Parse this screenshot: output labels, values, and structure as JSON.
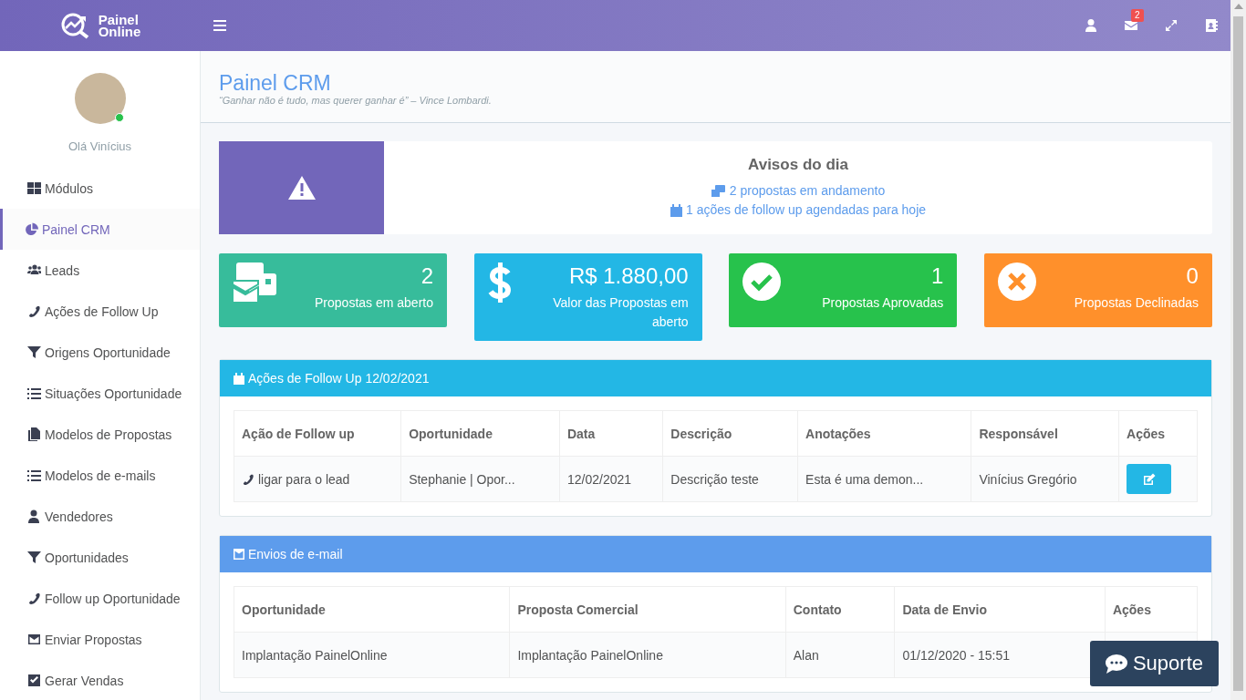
{
  "brand": {
    "line1": "Painel",
    "line2": "Online"
  },
  "topbar": {
    "mail_badge": "2"
  },
  "user": {
    "greeting": "Olá Vinícius",
    "online": true
  },
  "sidebar": {
    "items": [
      {
        "label": "Módulos",
        "selected": false
      },
      {
        "label": "Painel CRM",
        "selected": true
      },
      {
        "label": "Leads",
        "selected": false
      },
      {
        "label": "Ações de Follow Up",
        "selected": false
      },
      {
        "label": "Origens Oportunidade",
        "selected": false
      },
      {
        "label": "Situações Oportunidade",
        "selected": false
      },
      {
        "label": "Modelos de Propostas",
        "selected": false
      },
      {
        "label": "Modelos de e-mails",
        "selected": false
      },
      {
        "label": "Vendedores",
        "selected": false
      },
      {
        "label": "Oportunidades",
        "selected": false
      },
      {
        "label": "Follow up Oportunidade",
        "selected": false
      },
      {
        "label": "Enviar Propostas",
        "selected": false
      },
      {
        "label": "Gerar Vendas",
        "selected": false
      }
    ]
  },
  "header": {
    "title": "Painel CRM",
    "quote": "“Ganhar não é tudo, mas querer ganhar é” – Vince Lombardi."
  },
  "notices": {
    "title": "Avisos do dia",
    "items": [
      {
        "kind": "proposals",
        "text": "2 propostas em andamento"
      },
      {
        "kind": "calendar",
        "text": "1 ações de follow up agendadas para hoje"
      }
    ]
  },
  "stats": [
    {
      "kind": "proposals",
      "value": "2",
      "label": "Propostas em aberto",
      "color": "#37bc9b"
    },
    {
      "kind": "money",
      "value": "R$ 1.880,00",
      "label": "Valor das Propostas em aberto",
      "color": "#23b7e5"
    },
    {
      "kind": "approved",
      "value": "1",
      "label": "Propostas Aprovadas",
      "color": "#27c24c"
    },
    {
      "kind": "declined",
      "value": "0",
      "label": "Propostas Declinadas",
      "color": "#ff902b"
    }
  ],
  "panels": [
    {
      "kind": "calendar",
      "title": "Ações de Follow Up 12/02/2021",
      "color": "#23b7e5",
      "columns": [
        "Ação de Follow up",
        "Oportunidade",
        "Data",
        "Descrição",
        "Anotações",
        "Responsável",
        "Ações"
      ],
      "rows": [
        {
          "kind": "call",
          "action": true,
          "cells": [
            "ligar para o lead",
            "Stephanie | Opor...",
            "12/02/2021",
            "Descrição teste",
            "Esta é uma demon...",
            "Vinícius Gregório"
          ]
        }
      ]
    },
    {
      "kind": "email",
      "title": "Envios de e-mail",
      "color": "#5d9cec",
      "columns": [
        "Oportunidade",
        "Proposta Comercial",
        "Contato",
        "Data de Envio",
        "Ações"
      ],
      "rows": [
        {
          "kind": "plain",
          "action": false,
          "cells": [
            "Implantação PainelOnline",
            "Implantação PainelOnline",
            "Alan",
            "01/12/2020 - 15:51"
          ]
        }
      ]
    }
  ],
  "support": {
    "label": "Suporte"
  }
}
